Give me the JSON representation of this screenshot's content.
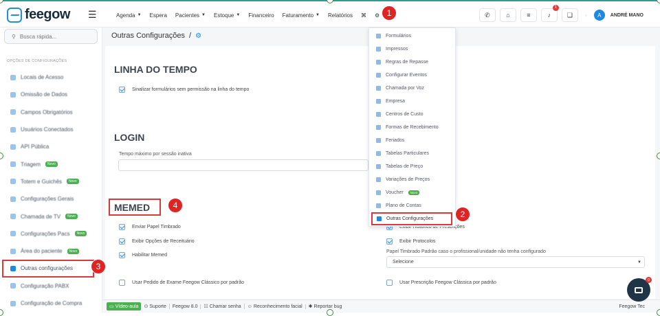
{
  "header": {
    "logo_text": "feegow",
    "nav": [
      {
        "label": "Agenda",
        "caret": true
      },
      {
        "label": "Espera",
        "caret": false
      },
      {
        "label": "Pacientes",
        "caret": true
      },
      {
        "label": "Estoque",
        "caret": true
      },
      {
        "label": "Financeiro",
        "caret": false
      },
      {
        "label": "Faturamento",
        "caret": true
      },
      {
        "label": "Relatórios",
        "caret": false
      }
    ],
    "notification_count": "1",
    "user_name": "ANDRÉ MANO",
    "user_initial": "A"
  },
  "sidebar": {
    "search_placeholder": "Busca rápida...",
    "heading": "OPÇÕES DE CONFIGURAÇÕES",
    "items": [
      {
        "label": "Locais de Acesso",
        "badge": ""
      },
      {
        "label": "Omissão de Dados",
        "badge": ""
      },
      {
        "label": "Campos Obrigatórios",
        "badge": ""
      },
      {
        "label": "Usuários Conectados",
        "badge": ""
      },
      {
        "label": "API Pública",
        "badge": ""
      },
      {
        "label": "Triagem",
        "badge": "Novo"
      },
      {
        "label": "Totem e Guichês",
        "badge": "Novo"
      },
      {
        "label": "Configurações Gerais",
        "badge": ""
      },
      {
        "label": "Chamada de TV",
        "badge": "Novo"
      },
      {
        "label": "Configurações Pacs",
        "badge": "Novo"
      },
      {
        "label": "Área do paciente",
        "badge": "Novo"
      },
      {
        "label": "Outras configurações",
        "badge": ""
      },
      {
        "label": "Configuração PABX",
        "badge": ""
      },
      {
        "label": "Configuração de Compra",
        "badge": ""
      }
    ]
  },
  "breadcrumb": {
    "title": "Outras Configurações",
    "separator": "/"
  },
  "content": {
    "timeline_title": "LINHA DO TEMPO",
    "timeline_option": "Sinalizar formulários sem permissão na linha do tempo",
    "login_title": "LOGIN",
    "login_label": "Tempo máximo por sessão inativa",
    "memed_title": "MEMED",
    "memed_left": [
      {
        "label": "Enviar Papel Timbrado",
        "checked": true
      },
      {
        "label": "Exibir Opções de Receituário",
        "checked": true
      },
      {
        "label": "Habilitar Memed",
        "checked": true
      }
    ],
    "memed_right": [
      {
        "label": "Exibir Histórico de Prescrições",
        "checked": true
      },
      {
        "label": "Exibir Protocolos",
        "checked": true
      }
    ],
    "papel_label": "Papel Timbrado Padrão caso o profissional/unidade não tenha configurado",
    "papel_select": "Selecione",
    "feegow_exam": "Usar Pedido de Exame Feegow Clássico por padrão",
    "feegow_presc": "Usar Prescrição Feegow Clássica por padrão"
  },
  "dropdown": {
    "items": [
      {
        "label": "Formulários",
        "badge": ""
      },
      {
        "label": "Impressos",
        "badge": ""
      },
      {
        "label": "Regras de Repasse",
        "badge": ""
      },
      {
        "label": "Configurar Eventos",
        "badge": ""
      },
      {
        "label": "Chamada por Voz",
        "badge": ""
      },
      {
        "label": "Empresa",
        "badge": ""
      },
      {
        "label": "Centros de Custo",
        "badge": ""
      },
      {
        "label": "Formas de Recebimento",
        "badge": ""
      },
      {
        "label": "Feriados",
        "badge": ""
      },
      {
        "label": "Tabelas Particulares",
        "badge": ""
      },
      {
        "label": "Tabelas de Preço",
        "badge": ""
      },
      {
        "label": "Variações de Preços",
        "badge": ""
      },
      {
        "label": "Voucher",
        "badge": "Novo"
      },
      {
        "label": "Plano de Contas",
        "badge": ""
      },
      {
        "label": "Outras Configurações",
        "badge": ""
      }
    ]
  },
  "steps": [
    "1",
    "2",
    "3",
    "4"
  ],
  "footer": {
    "items": [
      "Vídeo-aula",
      "Suporte",
      "Feegow 8.0",
      "Chamar senha",
      "Reconhecimento facial",
      "Reportar bug"
    ],
    "right_text": "Feegow Tec"
  },
  "chat_badge": "0",
  "colors": {
    "accent": "#1e88e5",
    "highlight": "#d9383e",
    "step": "#e02424"
  }
}
